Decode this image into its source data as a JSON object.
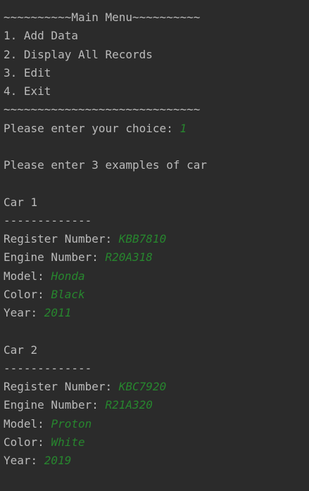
{
  "menu": {
    "header": "~~~~~~~~~~Main Menu~~~~~~~~~~",
    "options": [
      "1. Add Data",
      "2. Display All Records",
      "3. Edit",
      "4. Exit"
    ],
    "footer": "~~~~~~~~~~~~~~~~~~~~~~~~~~~~~"
  },
  "prompt": {
    "label": "Please enter your choice: ",
    "input": "1"
  },
  "instruction": "Please enter 3 examples of car",
  "cars": [
    {
      "title": "Car 1",
      "divider": "-------------",
      "fields": [
        {
          "label": "Register Number: ",
          "value": "KBB7810"
        },
        {
          "label": "Engine Number: ",
          "value": "R20A318"
        },
        {
          "label": "Model: ",
          "value": "Honda"
        },
        {
          "label": "Color: ",
          "value": "Black"
        },
        {
          "label": "Year: ",
          "value": "2011"
        }
      ]
    },
    {
      "title": "Car 2",
      "divider": "-------------",
      "fields": [
        {
          "label": "Register Number: ",
          "value": "KBC7920"
        },
        {
          "label": "Engine Number: ",
          "value": "R21A320"
        },
        {
          "label": "Model: ",
          "value": "Proton"
        },
        {
          "label": "Color: ",
          "value": "White"
        },
        {
          "label": "Year: ",
          "value": "2019"
        }
      ]
    }
  ],
  "colors": {
    "background": "#2b2b2b",
    "text": "#bbbbbb",
    "user_input": "#27862e"
  }
}
